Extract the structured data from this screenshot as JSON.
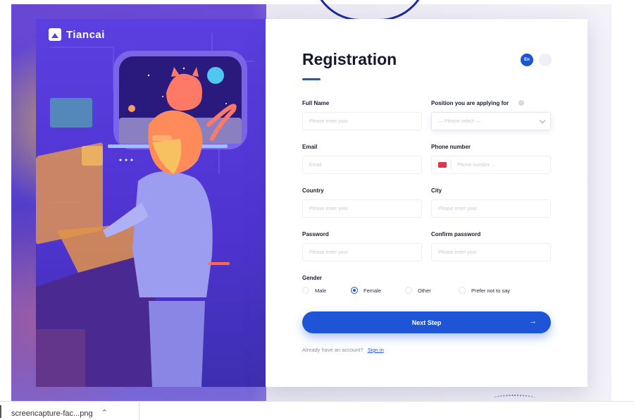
{
  "brand": {
    "name": "Tiancai"
  },
  "form": {
    "title": "Registration",
    "languages": {
      "active": "En",
      "alternate": "·"
    },
    "fields": {
      "full_name": {
        "label": "Full Name",
        "placeholder": "Please enter your"
      },
      "position": {
        "label": "Position you are applying for",
        "placeholder": "— Please select —"
      },
      "email": {
        "label": "Email",
        "placeholder": "Email"
      },
      "phone": {
        "label": "Phone number",
        "placeholder": "Phone number ..."
      },
      "country": {
        "label": "Country",
        "placeholder": "Please enter your"
      },
      "city": {
        "label": "City",
        "placeholder": "Please enter your"
      },
      "password": {
        "label": "Password",
        "placeholder": "Please enter your"
      },
      "confirm_password": {
        "label": "Confirm password",
        "placeholder": "Please enter your"
      }
    },
    "gender": {
      "label": "Gender",
      "options": [
        "Male",
        "Female",
        "Other",
        "Prefer not to say"
      ],
      "selected": "Female"
    },
    "next_button": "Next Step",
    "signin_prompt": "Already have an account?",
    "signin_link": "Sign in"
  },
  "download_bar": {
    "file_name": "screencapture-fac...png"
  },
  "colors": {
    "accent": "#1d55d6",
    "illustration_bg": "#5b3fe0",
    "flag": "#e0364a"
  }
}
